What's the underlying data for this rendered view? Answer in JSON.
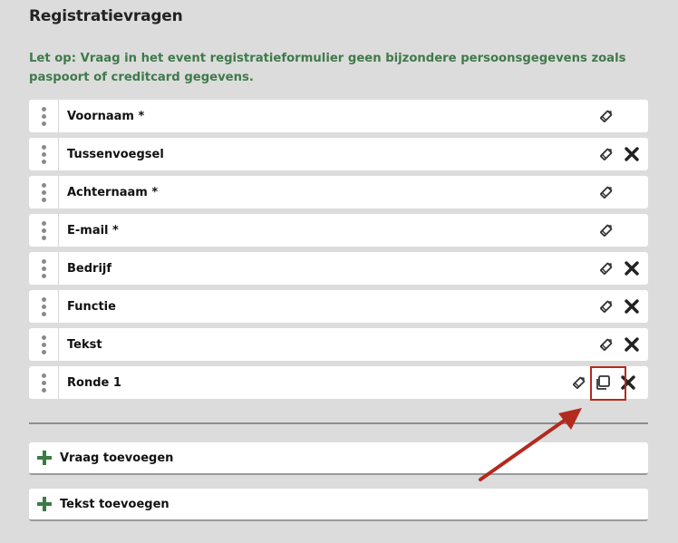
{
  "header": {
    "title": "Registratievragen",
    "notice": "Let op: Vraag in het event registratieformulier geen bijzondere persoonsgegevens zoals paspoort of creditcard gegevens."
  },
  "questions": [
    {
      "label": "Voornaam *",
      "edit_icon": "pencil-icon",
      "deletable": false,
      "copyable": false
    },
    {
      "label": "Tussenvoegsel",
      "edit_icon": "pencil-icon",
      "deletable": true,
      "copyable": false
    },
    {
      "label": "Achternaam *",
      "edit_icon": "pencil-icon",
      "deletable": false,
      "copyable": false
    },
    {
      "label": "E-mail *",
      "edit_icon": "pencil-icon",
      "deletable": false,
      "copyable": false
    },
    {
      "label": "Bedrijf",
      "edit_icon": "pencil-icon",
      "deletable": true,
      "copyable": false
    },
    {
      "label": "Functie",
      "edit_icon": "pencil-icon",
      "deletable": true,
      "copyable": false
    },
    {
      "label": "Tekst",
      "edit_icon": "pencil-icon",
      "deletable": true,
      "copyable": false
    },
    {
      "label": "Ronde 1",
      "edit_icon": "pencil-icon",
      "deletable": true,
      "copyable": true
    }
  ],
  "buttons": {
    "add_question": "Vraag toevoegen",
    "add_text": "Tekst toevoegen"
  },
  "colors": {
    "notice_green": "#3f7a4a",
    "plus_green": "#3d7a45",
    "annotation_red": "#b32a1e",
    "background": "#dcdcdc"
  },
  "annotation": {
    "target": "copy-icon",
    "shape": "red box with arrow"
  }
}
